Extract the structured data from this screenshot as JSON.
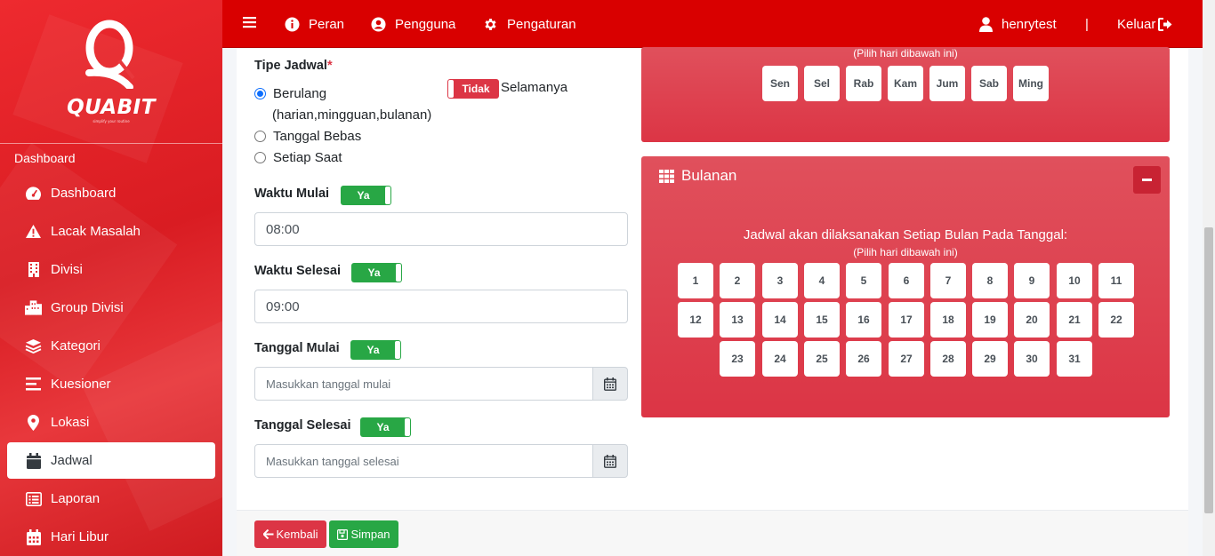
{
  "brand": {
    "name": "QUABIT",
    "tagline": "simplify your routine",
    "primary_color": "#d90000"
  },
  "topbar": {
    "menu_icon": "hamburger-icon",
    "items": [
      {
        "label": "Peran",
        "icon": "info-circle-icon"
      },
      {
        "label": "Pengguna",
        "icon": "user-circle-icon"
      },
      {
        "label": "Pengaturan",
        "icon": "gear-icon"
      }
    ],
    "user": "henrytest",
    "separator": "|",
    "logout": "Keluar"
  },
  "sidebar": {
    "header": "Dashboard",
    "items": [
      {
        "label": "Dashboard",
        "icon": "tachometer-icon"
      },
      {
        "label": "Lacak Masalah",
        "icon": "warning-icon"
      },
      {
        "label": "Divisi",
        "icon": "building-icon"
      },
      {
        "label": "Group Divisi",
        "icon": "city-icon"
      },
      {
        "label": "Kategori",
        "icon": "layers-icon"
      },
      {
        "label": "Kuesioner",
        "icon": "align-left-icon"
      },
      {
        "label": "Lokasi",
        "icon": "map-marker-icon"
      },
      {
        "label": "Jadwal",
        "icon": "calendar-icon",
        "active": true
      },
      {
        "label": "Laporan",
        "icon": "list-alt-icon"
      },
      {
        "label": "Hari Libur",
        "icon": "calendar-days-icon"
      }
    ]
  },
  "form": {
    "tipe_jadwal": {
      "label": "Tipe Jadwal",
      "required_mark": "*",
      "options": [
        {
          "label": "Berulang",
          "checked": true
        },
        {
          "label": "Tanggal Bebas",
          "checked": false
        },
        {
          "label": "Setiap Saat",
          "checked": false
        }
      ],
      "berulang_note": "(harian,mingguan,bulanan)",
      "selamanya_toggle": "Tidak",
      "selamanya_label": "Selamanya"
    },
    "waktu_mulai": {
      "label": "Waktu Mulai",
      "toggle": "Ya",
      "value": "08:00"
    },
    "waktu_selesai": {
      "label": "Waktu Selesai",
      "toggle": "Ya",
      "value": "09:00"
    },
    "tanggal_mulai": {
      "label": "Tanggal Mulai",
      "toggle": "Ya",
      "placeholder": "Masukkan tanggal mulai"
    },
    "tanggal_selesai": {
      "label": "Tanggal Selesai",
      "toggle": "Ya",
      "placeholder": "Masukkan tanggal selesai"
    }
  },
  "weekly_panel": {
    "hint": "(Pilih hari dibawah ini)",
    "days": [
      "Sen",
      "Sel",
      "Rab",
      "Kam",
      "Jum",
      "Sab",
      "Ming"
    ]
  },
  "monthly_panel": {
    "title": "Bulanan",
    "title_icon": "grid-icon",
    "collapse_icon": "minus-icon",
    "heading": "Jadwal akan dilaksanakan Setiap Bulan Pada Tanggal:",
    "hint": "(Pilih hari dibawah ini)",
    "dates": [
      "1",
      "2",
      "3",
      "4",
      "5",
      "6",
      "7",
      "8",
      "9",
      "10",
      "11",
      "12",
      "13",
      "14",
      "15",
      "16",
      "17",
      "18",
      "19",
      "20",
      "21",
      "22",
      "23",
      "24",
      "25",
      "26",
      "27",
      "28",
      "29",
      "30",
      "31"
    ],
    "panel_color": "#dc3545"
  },
  "footer": {
    "back_label": "Kembali",
    "save_label": "Simpan",
    "back_color": "#dc3545",
    "save_color": "#28a745"
  }
}
